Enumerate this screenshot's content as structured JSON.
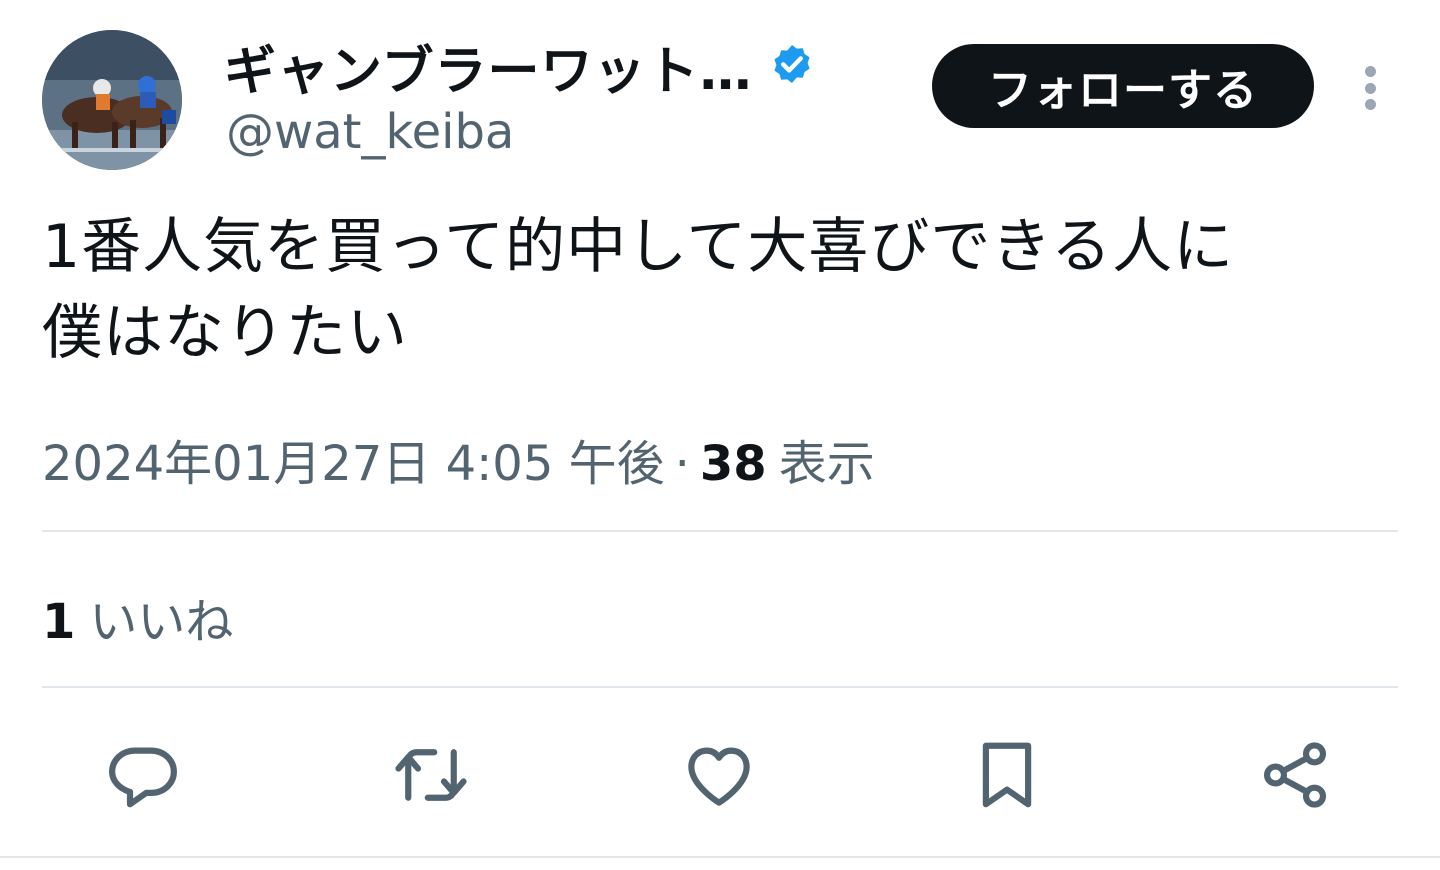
{
  "author": {
    "display_name": "ギャンブラーワット…",
    "handle": "@wat_keiba",
    "verified": true,
    "avatar_icon": "horse-racing-photo"
  },
  "follow_button": {
    "label": "フォローする"
  },
  "more_menu": {
    "icon": "more-vertical-icon"
  },
  "tweet": {
    "text_line1": "1番人気を買って的中して大喜びできる人に",
    "text_line2": "僕はなりたい"
  },
  "meta": {
    "timestamp": "2024年01月27日 4:05 午後",
    "separator": "·",
    "views_count": "38",
    "views_label": "表示"
  },
  "stats": {
    "likes_count": "1",
    "likes_label": "いいね"
  },
  "actions": [
    {
      "name": "reply",
      "icon": "reply-icon"
    },
    {
      "name": "retweet",
      "icon": "retweet-icon"
    },
    {
      "name": "like",
      "icon": "heart-icon"
    },
    {
      "name": "bookmark",
      "icon": "bookmark-icon"
    },
    {
      "name": "share",
      "icon": "share-icon"
    }
  ],
  "colors": {
    "text_primary": "#0f1419",
    "text_secondary": "#536471",
    "verified_blue": "#1d9bf0",
    "icon_gray": "#536471",
    "divider": "#e1e6ea"
  }
}
